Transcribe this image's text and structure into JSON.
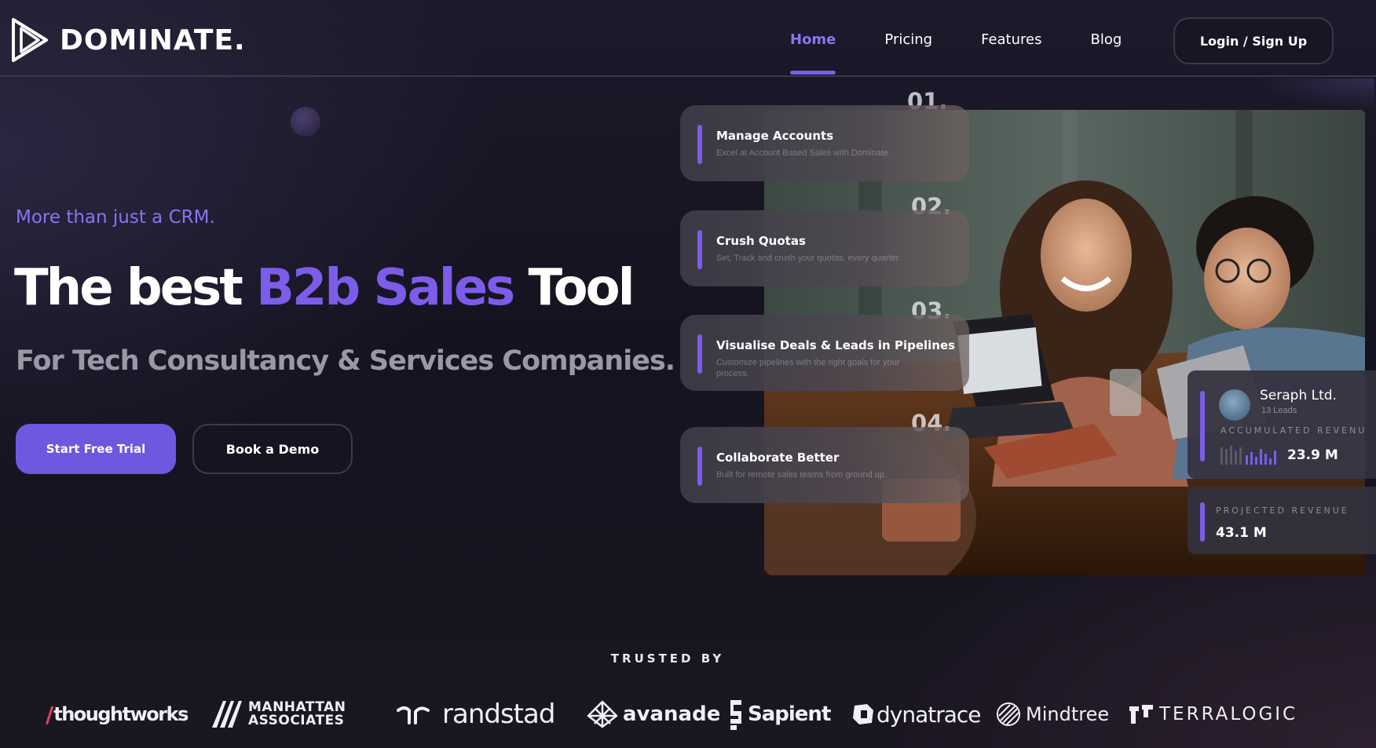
{
  "nav": {
    "brand": "DOMINATE.",
    "links": [
      {
        "label": "Home",
        "active": true
      },
      {
        "label": "Pricing",
        "active": false
      },
      {
        "label": "Features",
        "active": false
      },
      {
        "label": "Blog",
        "active": false
      }
    ],
    "login_label": "Login / Sign Up"
  },
  "hero": {
    "tagline": "More than just a CRM.",
    "headline_pre": "The best ",
    "headline_accent": "B2b Sales",
    "headline_post": " Tool",
    "subhead": "For Tech Consultancy & Services Companies.",
    "primary_cta": "Start Free Trial",
    "secondary_cta": "Book a Demo"
  },
  "features": [
    {
      "num": "01.",
      "title": "Manage Accounts",
      "desc": "Excel at Account Based Sales with Dominate."
    },
    {
      "num": "02.",
      "title": "Crush Quotas",
      "desc": "Set, Track and crush your quotas, every quarter."
    },
    {
      "num": "03.",
      "title": "Visualise Deals & Leads in Pipelines",
      "desc": "Customize pipelines with the right goals for your process."
    },
    {
      "num": "04.",
      "title": "Collaborate Better",
      "desc": "Built for remote sales teams from ground up."
    }
  ],
  "stats": {
    "company": "Seraph Ltd.",
    "leads": "13 Leads",
    "accumulated_label": "ACCUMULATED REVENU",
    "accumulated_value": "23.9 M",
    "projected_label": "PROJECTED REVENUE",
    "projected_value": "43.1 M"
  },
  "trusted": {
    "heading": "TRUSTED BY",
    "logos": {
      "thoughtworks": "thoughtworks",
      "manhattan_line1": "MANHATTAN",
      "manhattan_line2": "ASSOCIATES",
      "randstad": "randstad",
      "avanade": "avanade",
      "sapient": "Sapient",
      "dynatrace": "dynatrace",
      "mindtree": "Mindtree",
      "terralogic": "TERRALOGIC"
    }
  },
  "colors": {
    "accent": "#7c5ce8",
    "accent_text": "#8b74f0",
    "primary_button": "#6f57e0",
    "background": "#16151f"
  }
}
